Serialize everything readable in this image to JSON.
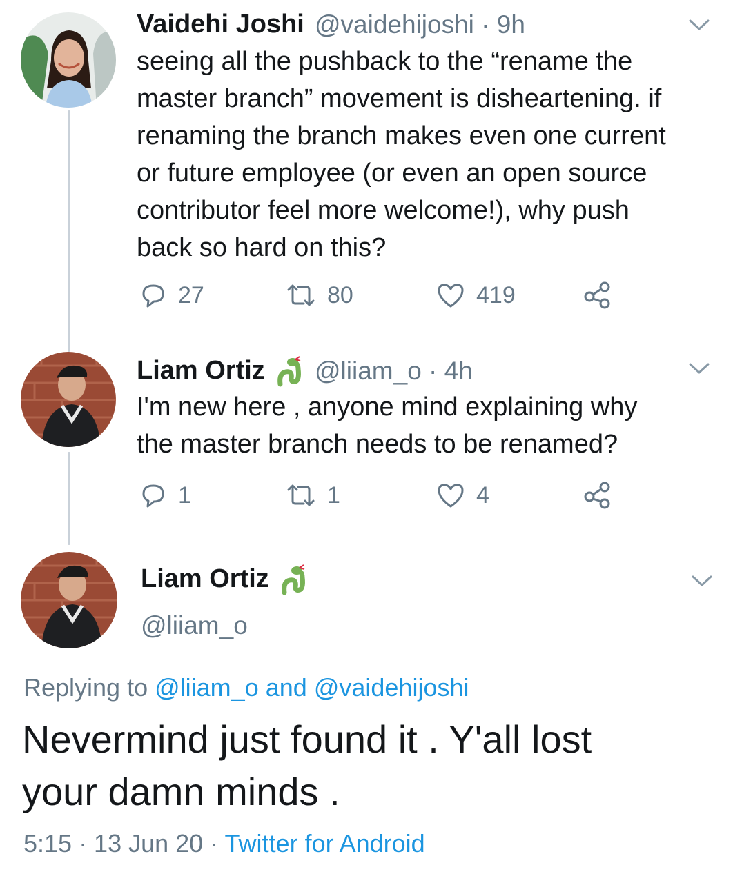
{
  "tweet1": {
    "name": "Vaidehi Joshi",
    "handle_time": "@vaidehijoshi · 9h",
    "text_lines": [
      "seeing all the pushback to the “rename the",
      "master branch” movement is disheartening. if",
      "renaming the branch makes even one current",
      "or future employee (or even an open source",
      "contributor feel more welcome!), why push",
      "back so hard on this?"
    ],
    "replies": "27",
    "retweets": "80",
    "likes": "419"
  },
  "tweet2": {
    "name": "Liam Ortiz",
    "emoji_icon": "snake-icon",
    "handle_time": "@liiam_o · 4h",
    "text_lines": [
      "I'm new here , anyone mind explaining why",
      "the master branch needs to be renamed?"
    ],
    "replies": "1",
    "retweets": "1",
    "likes": "4"
  },
  "main_tweet": {
    "name": "Liam Ortiz",
    "emoji_icon": "snake-icon",
    "handle": "@liiam_o",
    "replying_prefix": "Replying to",
    "mention1": "@liiam_o",
    "and_word": "and",
    "mention2": "@vaidehijoshi",
    "text_lines": [
      "Nevermind just found it . Y'all lost",
      "your damn minds ."
    ],
    "time_date": "5:15 · 13 Jun 20 ·",
    "source": "Twitter for Android"
  },
  "colors": {
    "link": "#1b95e0",
    "secondary_text": "#657786",
    "primary_text": "#14171a",
    "thread_line": "#c9d1d9",
    "snake_green": "#77b255"
  }
}
